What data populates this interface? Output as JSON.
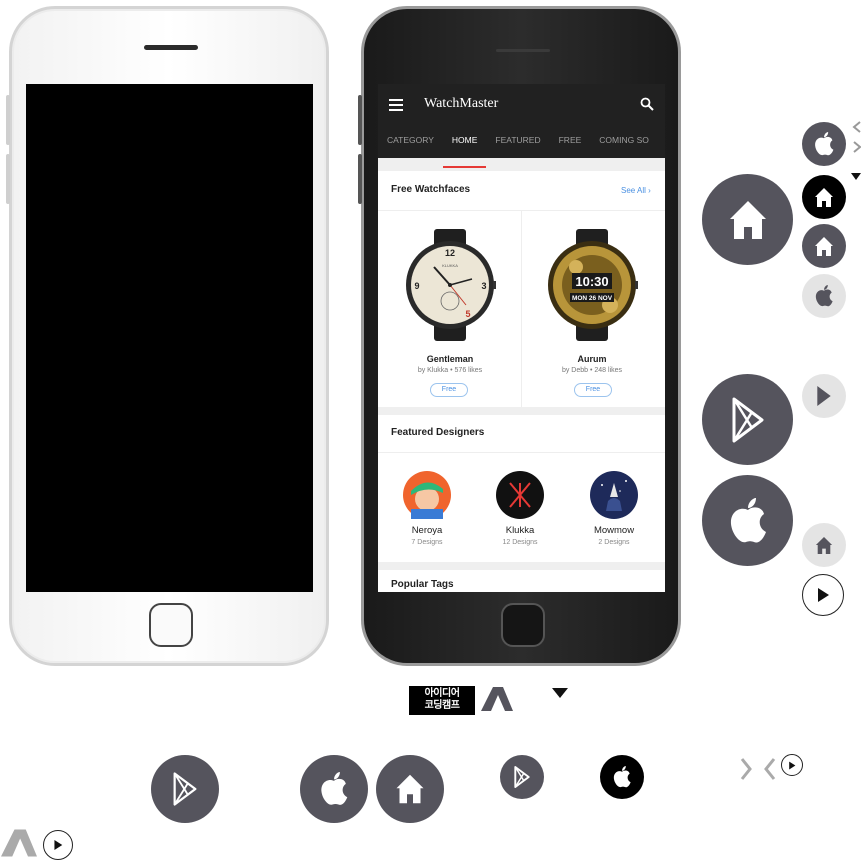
{
  "app": {
    "title": "WatchMaster",
    "tabs": [
      "CATEGORY",
      "HOME",
      "FEATURED",
      "FREE",
      "COMING SO"
    ],
    "active_tab": "HOME"
  },
  "free_watchfaces": {
    "title": "Free Watchfaces",
    "see_all": "See All",
    "items": [
      {
        "name": "Gentleman",
        "designer": "by Klukka",
        "likes": "576 likes",
        "badge": "Free",
        "dial_brand": "KLUKKA"
      },
      {
        "name": "Aurum",
        "designer": "by Debb",
        "likes": "248 likes",
        "badge": "Free",
        "dial_time": "10:30",
        "dial_date": "MON 26 NOV"
      }
    ]
  },
  "featured_designers": {
    "title": "Featured Designers",
    "items": [
      {
        "name": "Neroya",
        "count": "7 Designs"
      },
      {
        "name": "Klukka",
        "count": "12 Designs"
      },
      {
        "name": "Mowmow",
        "count": "2 Designs"
      }
    ]
  },
  "popular_tags": {
    "title": "Popular Tags"
  },
  "logo": {
    "line1": "아이디어",
    "line2": "코딩캠프"
  },
  "colors": {
    "appbar": "#212121",
    "accent": "#e53935",
    "link": "#4a90e2",
    "icon_dark": "#55545d"
  },
  "icons": [
    "home-icon",
    "apple-icon",
    "play-store-icon",
    "play-icon",
    "chevron-icon",
    "caret-down-icon"
  ]
}
